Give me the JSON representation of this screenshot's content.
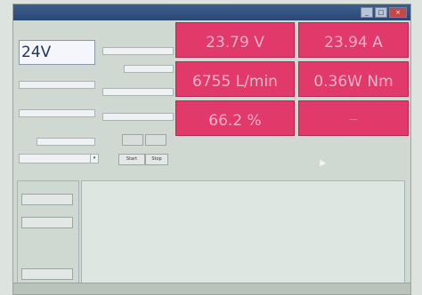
{
  "window": {
    "title": "",
    "min_glyph": "_",
    "max_glyph": "□",
    "close_glyph": "×"
  },
  "panel": {
    "voltage_caption": "",
    "voltage_value": "24V",
    "config_button": "",
    "start_button": "Start",
    "stop_button": "Stop",
    "apply_button": "",
    "clear_button": "",
    "save_button": "",
    "settings_button": "",
    "exit_button": ""
  },
  "status": {
    "text": ""
  },
  "tiles": [
    {
      "caption": "",
      "value": "23.79 V",
      "dash": ""
    },
    {
      "caption": "",
      "value": "23.94 A",
      "dash": ""
    },
    {
      "caption": "",
      "value": "6755 L/min",
      "dash": ""
    },
    {
      "caption": "",
      "value": "0.36W Nm",
      "dash": ""
    },
    {
      "caption": "",
      "value": "66.2 %",
      "dash": ""
    },
    {
      "caption": "",
      "value": "",
      "dash": "----"
    }
  ],
  "colors": {
    "tile": "#e1396a",
    "tile_text": "#ffb4c8"
  }
}
